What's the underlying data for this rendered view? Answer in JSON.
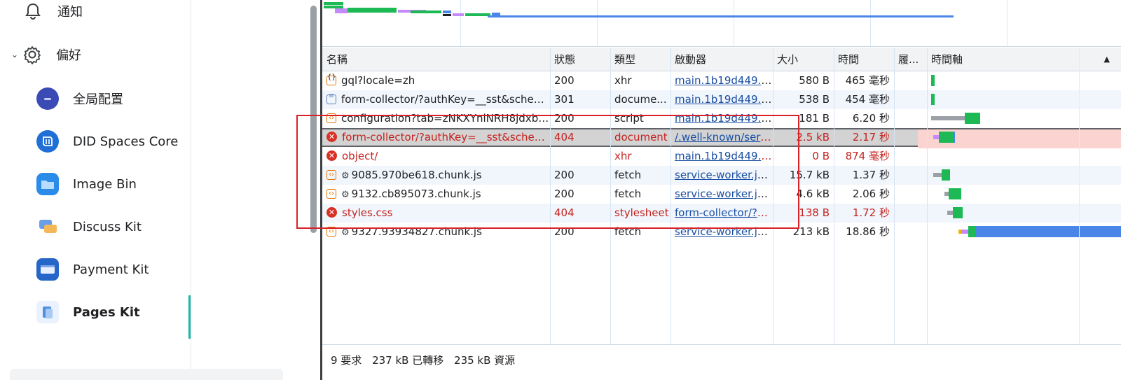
{
  "sidebar": {
    "top_item": {
      "label": "通知",
      "icon": "bell-icon"
    },
    "section": {
      "label": "偏好",
      "icon": "gear-icon",
      "expanded_icon": "chevron-down-icon"
    },
    "items": [
      {
        "label": "全局配置",
        "icon": "global-config-icon",
        "color": "#3b4bb5"
      },
      {
        "label": "DID Spaces Core",
        "icon": "did-spaces-icon",
        "color": "#1f6fd6"
      },
      {
        "label": "Image Bin",
        "icon": "folder-icon",
        "color": "#2b8be8"
      },
      {
        "label": "Discuss Kit",
        "icon": "chat-icon",
        "color": "#6b9ee8"
      },
      {
        "label": "Payment Kit",
        "icon": "payment-window-icon",
        "color": "#2566c8"
      },
      {
        "label": "Pages Kit",
        "icon": "pages-icon",
        "color": "#4d8fe0",
        "active": true
      }
    ]
  },
  "network": {
    "columns": [
      "名稱",
      "狀態",
      "類型",
      "啟動器",
      "大小",
      "時間",
      "履...",
      "時間軸"
    ],
    "sort_indicator": "▲",
    "rows": [
      {
        "name": "gql?locale=zh",
        "status": "200",
        "type": "xhr",
        "initiator": "main.1b19d449.js:2",
        "size": "580 B",
        "time": "465 毫秒",
        "kind": "xhr",
        "error": false
      },
      {
        "name": "form-collector/?authKey=__sst&schemaK...",
        "status": "301",
        "type": "docume...",
        "initiator": "main.1b19d449.js:2",
        "size": "538 B",
        "time": "454 毫秒",
        "kind": "doc",
        "error": false
      },
      {
        "name": "configuration?tab=zNKXYniNRH8jdxbgRc...",
        "status": "200",
        "type": "script",
        "initiator": "main.1b19d449.js:2",
        "size": "181 B",
        "time": "6.20 秒",
        "kind": "script",
        "error": false
      },
      {
        "name": "form-collector/?authKey=__sst&schemaK...",
        "status": "404",
        "type": "document",
        "initiator": "/.well-known/serv...",
        "size": "2.5 kB",
        "time": "2.17 秒",
        "kind": "err",
        "error": true,
        "selected": true
      },
      {
        "name": "object/",
        "status": "",
        "type": "xhr",
        "initiator": "main.1b19d449.js:2",
        "size": "0 B",
        "time": "874 毫秒",
        "kind": "err",
        "error": true
      },
      {
        "name": "9085.970be618.chunk.js",
        "status": "200",
        "type": "fetch",
        "initiator": "service-worker.js:1",
        "size": "15.7 kB",
        "time": "1.37 秒",
        "kind": "script",
        "error": false,
        "gear": true
      },
      {
        "name": "9132.cb895073.chunk.js",
        "status": "200",
        "type": "fetch",
        "initiator": "service-worker.js:1",
        "size": "4.6 kB",
        "time": "2.06 秒",
        "kind": "script",
        "error": false,
        "gear": true
      },
      {
        "name": "styles.css",
        "status": "404",
        "type": "stylesheet",
        "initiator": "form-collector/?a...",
        "size": "138 B",
        "time": "1.72 秒",
        "kind": "err",
        "error": true
      },
      {
        "name": "9327.93934827.chunk.js",
        "status": "200",
        "type": "fetch",
        "initiator": "service-worker.js:1",
        "size": "213 kB",
        "time": "18.86 秒",
        "kind": "script",
        "error": false,
        "gear": true
      }
    ],
    "footer": {
      "requests": "9 要求",
      "transferred": "237 kB 已轉移",
      "resources": "235 kB 資源"
    }
  },
  "colors": {
    "error": "#c5221f",
    "link": "#1a4fa3",
    "highlight_box": "#d9212a",
    "waterfall_green": "#1db954",
    "waterfall_blue": "#4a86e8"
  }
}
